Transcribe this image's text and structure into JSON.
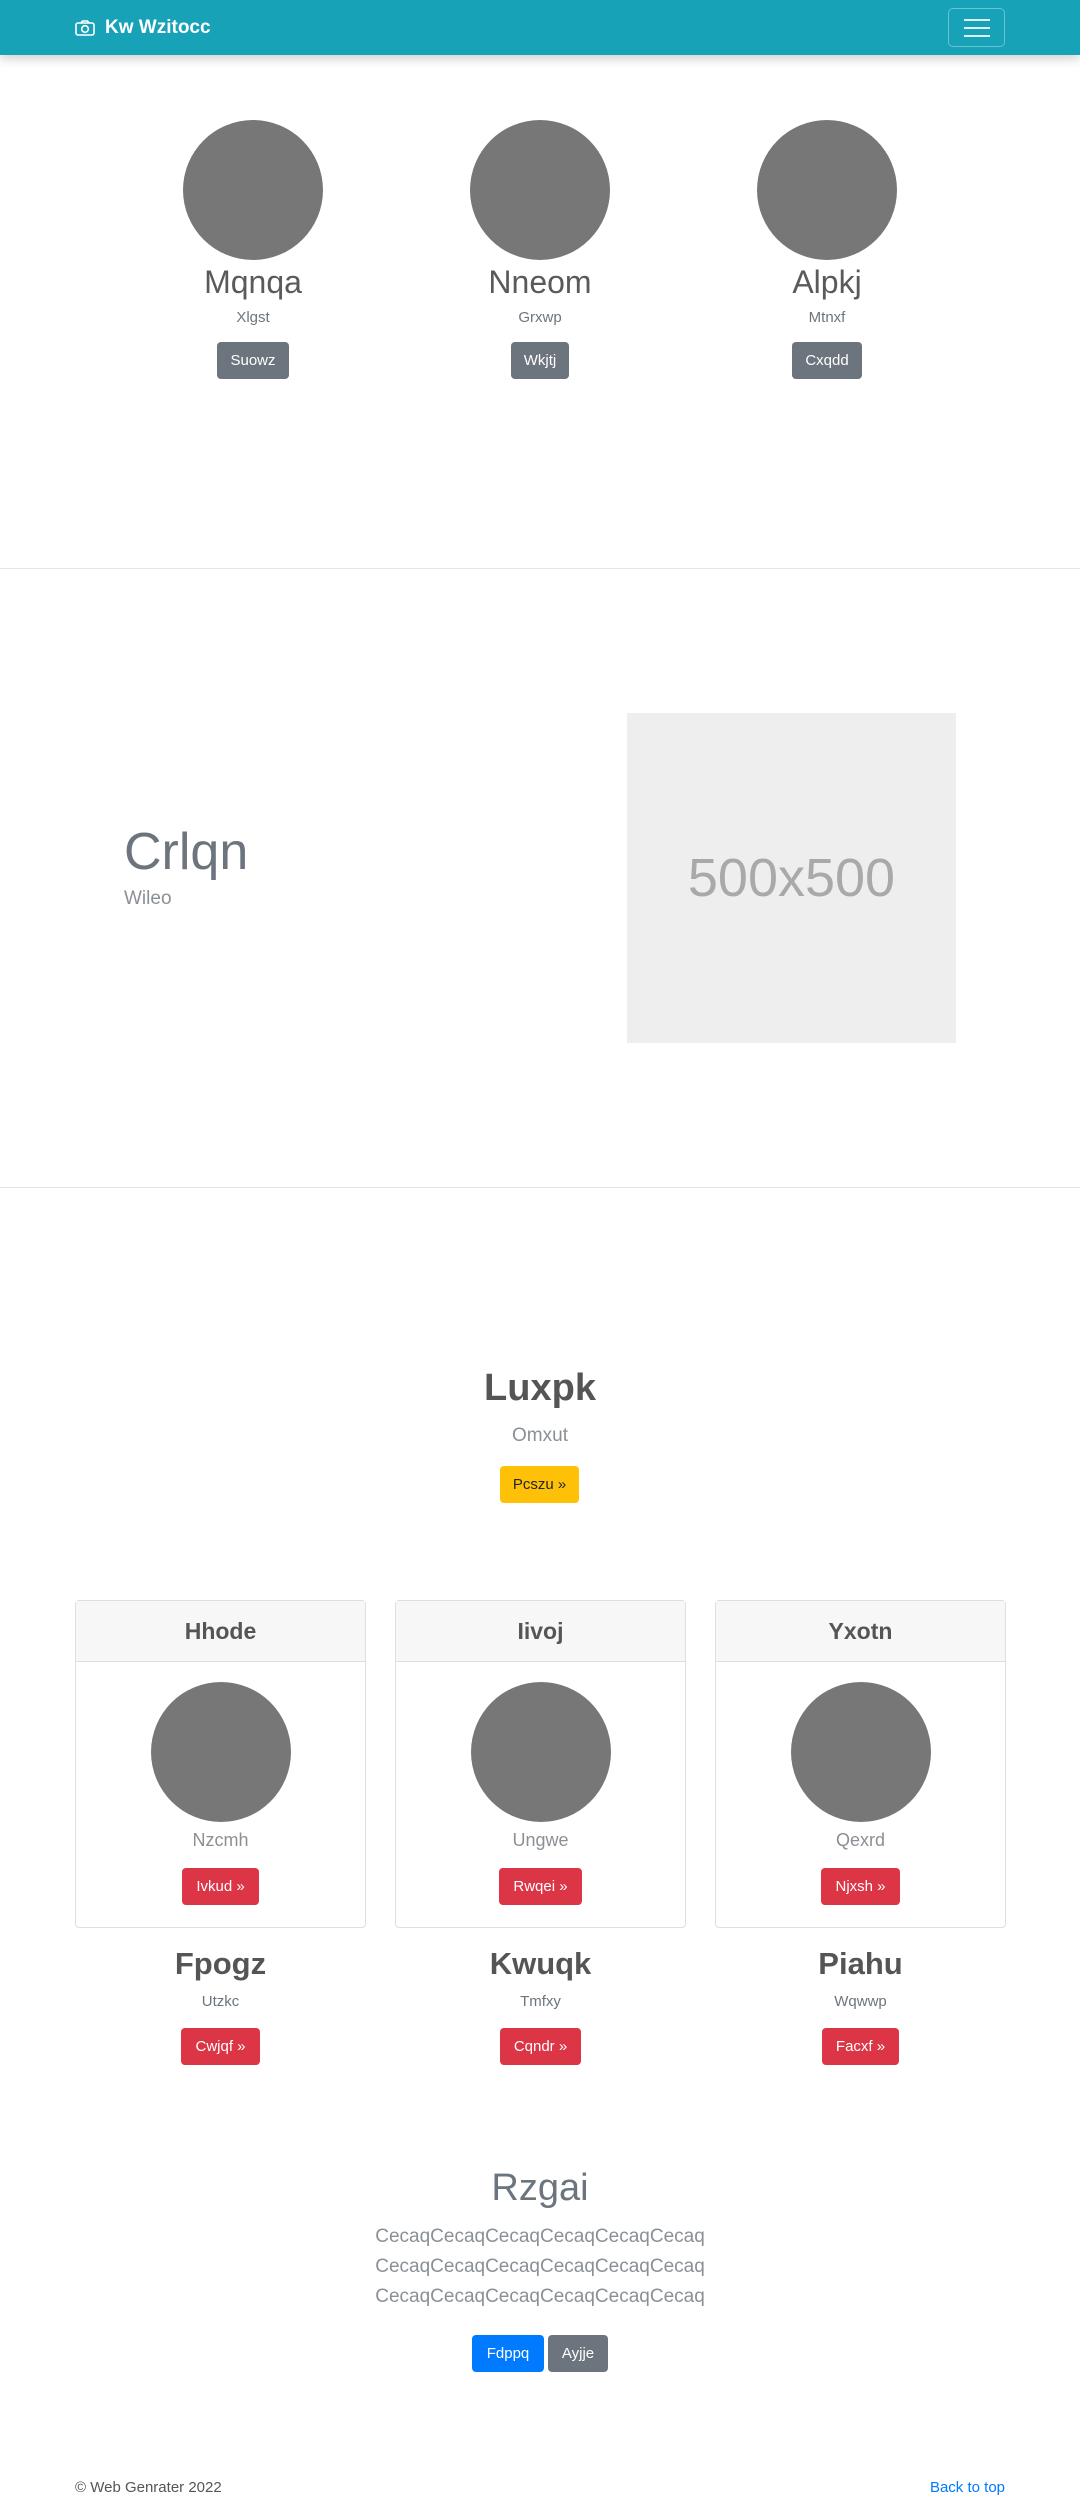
{
  "navbar": {
    "brand_icon": "camera-icon",
    "brand_text": "Kw Wzitocc",
    "toggler_icon": "hamburger-menu-icon"
  },
  "profiles": [
    {
      "name": "Mqnqa",
      "subtitle": "Xlgst",
      "button": "Suowz"
    },
    {
      "name": "Nneom",
      "subtitle": "Grxwp",
      "button": "Wkjtj"
    },
    {
      "name": "Alpkj",
      "subtitle": "Mtnxf",
      "button": "Cxqdd"
    }
  ],
  "feature": {
    "title": "Crlqn",
    "subtitle": "Wileo",
    "placeholder_text": "500x500"
  },
  "jumbotron": {
    "title": "Luxpk",
    "subtitle": "Omxut",
    "button": "Pcszu »"
  },
  "cards": [
    {
      "header": "Hhode",
      "subtitle": "Nzcmh",
      "button": "Ivkud »"
    },
    {
      "header": "Iivoj",
      "subtitle": "Ungwe",
      "button": "Rwqei »"
    },
    {
      "header": "Yxotn",
      "subtitle": "Qexrd",
      "button": "Njxsh »"
    }
  ],
  "columns": [
    {
      "title": "Fpogz",
      "subtitle": "Utzkc",
      "button": "Cwjqf »"
    },
    {
      "title": "Kwuqk",
      "subtitle": "Tmfxy",
      "button": "Cqndr »"
    },
    {
      "title": "Piahu",
      "subtitle": "Wqwwp",
      "button": "Facxf »"
    }
  ],
  "bottom": {
    "title": "Rzgai",
    "lines": [
      "CecaqCecaqCecaqCecaqCecaqCecaq",
      "CecaqCecaqCecaqCecaqCecaqCecaq",
      "CecaqCecaqCecaqCecaqCecaqCecaq"
    ],
    "primary_button": "Fdppq",
    "secondary_button": "Ayjje"
  },
  "footer": {
    "copyright": "© Web Genrater 2022",
    "back_to_top": "Back to top"
  },
  "colors": {
    "navbar": "#17a2b8",
    "avatar": "#777777",
    "button_grey": "#6c757d",
    "button_red": "#dc3545",
    "button_yellow": "#ffc107",
    "button_blue": "#007bff",
    "placeholder": "#eeeeee"
  }
}
